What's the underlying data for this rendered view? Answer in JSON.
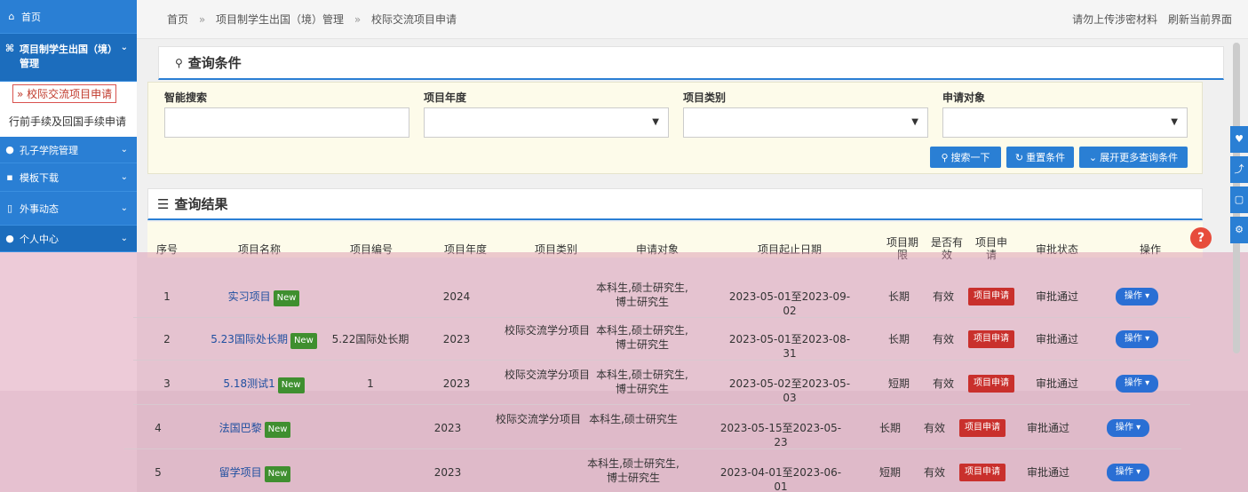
{
  "sidebar": {
    "home": "首页",
    "project": "项目制学生出国（境）管理",
    "sub_exchange": "校际交流项目申请",
    "sub_formalities": "行前手续及回国手续申请",
    "confucius": "孔子学院管理",
    "templates": "模板下载",
    "foreign_news": "外事动态",
    "personal": "个人中心"
  },
  "breadcrumb": {
    "home": "首页",
    "sep": "»",
    "level1": "项目制学生出国（境）管理",
    "level2": "校际交流项目申请"
  },
  "topright": {
    "notice": "请勿上传涉密材料",
    "refresh": "刷新当前界面"
  },
  "query": {
    "title": "查询条件",
    "smart_search": "智能搜索",
    "year": "项目年度",
    "category": "项目类别",
    "target": "申请对象",
    "search_btn": "搜索一下",
    "reset_btn": "重置条件",
    "more_btn": "展开更多查询条件"
  },
  "results": {
    "title": "查询结果",
    "headers": [
      "序号",
      "项目名称",
      "项目编号",
      "项目年度",
      "项目类别",
      "申请对象",
      "项目起止日期",
      "项目期限",
      "是否有效",
      "项目申请",
      "审批状态",
      "操作"
    ],
    "new_badge": "New",
    "apply_label": "项目申请",
    "op_label": "操作",
    "rows": [
      {
        "no": "1",
        "name": "实习项目",
        "code": "",
        "year": "2024",
        "category": "",
        "target": "本科生,硕士研究生,博士研究生",
        "dates": "2023-05-01至2023-09-02",
        "term": "长期",
        "valid": "有效",
        "status": "审批通过"
      },
      {
        "no": "2",
        "name": "5.23国际处长期",
        "code": "5.22国际处长期",
        "year": "2023",
        "category": "校际交流学分项目",
        "target": "本科生,硕士研究生,博士研究生",
        "dates": "2023-05-01至2023-08-31",
        "term": "长期",
        "valid": "有效",
        "status": "审批通过"
      },
      {
        "no": "3",
        "name": "5.18测试1",
        "code": "1",
        "year": "2023",
        "category": "校际交流学分项目",
        "target": "本科生,硕士研究生,博士研究生",
        "dates": "2023-05-02至2023-05-03",
        "term": "短期",
        "valid": "有效",
        "status": "审批通过"
      },
      {
        "no": "4",
        "name": "法国巴黎",
        "code": "",
        "year": "2023",
        "category": "校际交流学分项目",
        "target": "本科生,硕士研究生",
        "dates": "2023-05-15至2023-05-23",
        "term": "长期",
        "valid": "有效",
        "status": "审批通过"
      },
      {
        "no": "5",
        "name": "留学项目",
        "code": "",
        "year": "2023",
        "category": "",
        "target": "本科生,硕士研究生,博士研究生",
        "dates": "2023-04-01至2023-06-01",
        "term": "短期",
        "valid": "有效",
        "status": "审批通过"
      }
    ]
  }
}
